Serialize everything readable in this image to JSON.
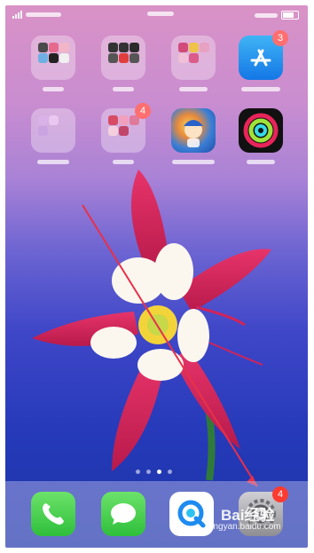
{
  "status_bar": {
    "icons": [
      "signal-icon",
      "wifi-icon",
      "battery-icon"
    ]
  },
  "home_grid": {
    "row1": [
      {
        "name": "folder-1",
        "type": "folder"
      },
      {
        "name": "folder-2",
        "type": "folder"
      },
      {
        "name": "folder-3",
        "type": "folder"
      },
      {
        "name": "app-store",
        "type": "app",
        "icon": "app-store-icon",
        "badge": "3"
      }
    ],
    "row2": [
      {
        "name": "folder-4",
        "type": "folder"
      },
      {
        "name": "folder-5",
        "type": "folder",
        "badge": "4"
      },
      {
        "name": "game-app",
        "type": "app",
        "icon": "game-icon"
      },
      {
        "name": "activity-app",
        "type": "app",
        "icon": "activity-rings-icon"
      }
    ]
  },
  "page_dots": {
    "count": 4,
    "active_index": 2
  },
  "dock": {
    "apps": [
      {
        "name": "phone",
        "icon": "phone-icon"
      },
      {
        "name": "messages",
        "icon": "messages-icon"
      },
      {
        "name": "browser",
        "icon": "browser-icon"
      },
      {
        "name": "settings",
        "icon": "gear-icon",
        "badge": "4"
      }
    ]
  },
  "watermark": {
    "brand": "Bai",
    "brand_suffix": "经验",
    "url": "jingyan.baidu.com"
  },
  "colors": {
    "badge": "#ff3b30",
    "annotation_arrow": "#e8304a",
    "flower_petal": "#d0245a"
  }
}
